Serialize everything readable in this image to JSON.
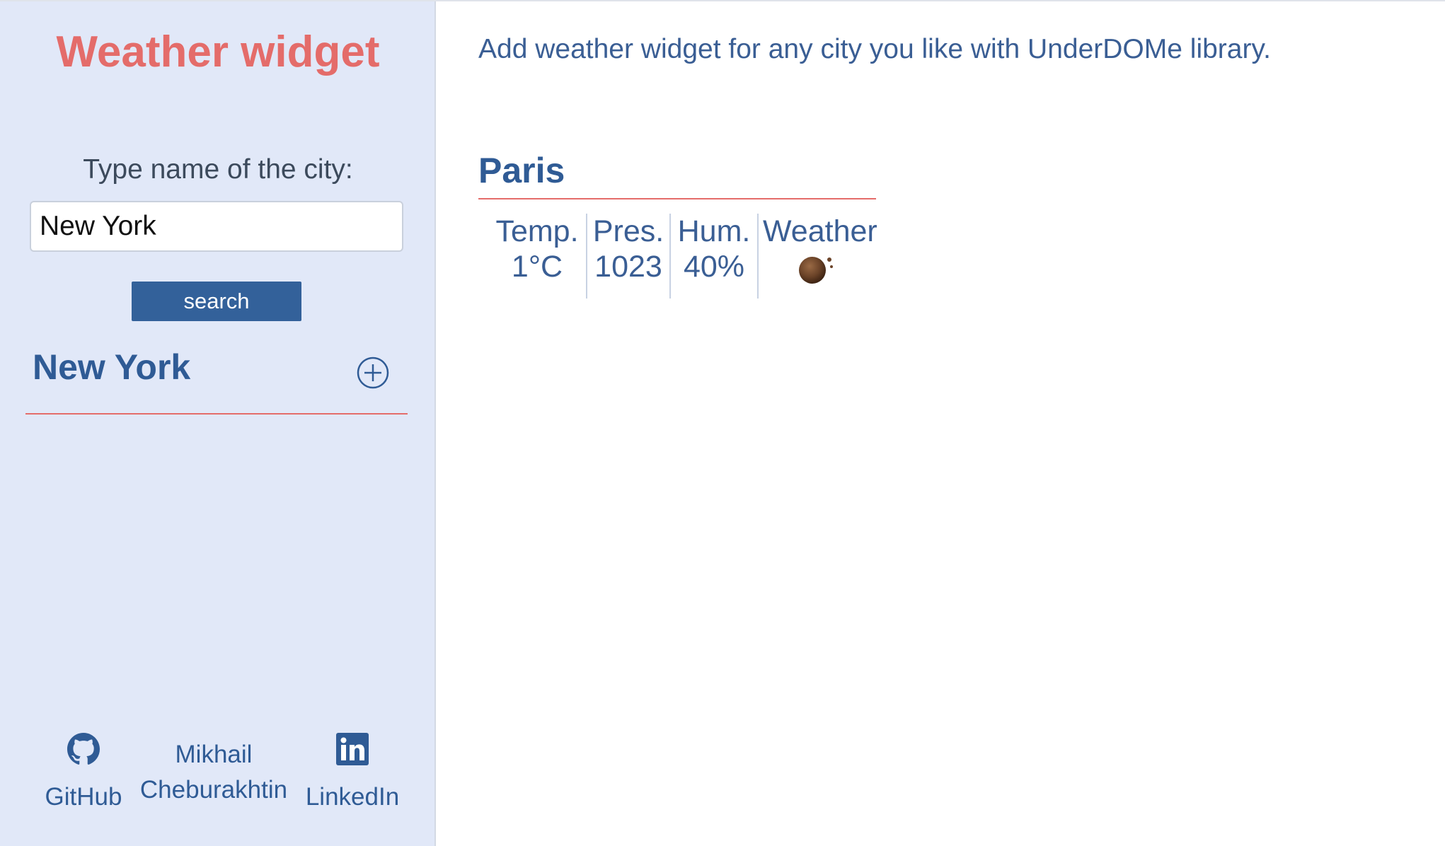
{
  "sidebar": {
    "title": "Weather widget",
    "city_label": "Type name of the city:",
    "search_value": "New York",
    "search_button_label": "search",
    "result_city": "New York",
    "add_icon": "plus-circle-icon",
    "footer": {
      "github_label": "GitHub",
      "github_icon": "github-icon",
      "author_first": "Mikhail",
      "author_last": "Cheburakhtin",
      "linkedin_label": "LinkedIn",
      "linkedin_icon": "linkedin-icon"
    }
  },
  "main": {
    "intro": "Add weather widget for any city you like with UnderDOMe library.",
    "widget": {
      "city": "Paris",
      "columns": [
        {
          "header": "Temp.",
          "value": "1°C"
        },
        {
          "header": "Pres.",
          "value": "1023"
        },
        {
          "header": "Hum.",
          "value": "40%"
        },
        {
          "header": "Weather",
          "value": ""
        }
      ],
      "weather_icon": "moon-icon"
    }
  },
  "colors": {
    "accent": "#e46c6a",
    "brand_blue": "#2f5b95",
    "button_blue": "#33619a",
    "sidebar_bg": "#e1e8f8"
  }
}
